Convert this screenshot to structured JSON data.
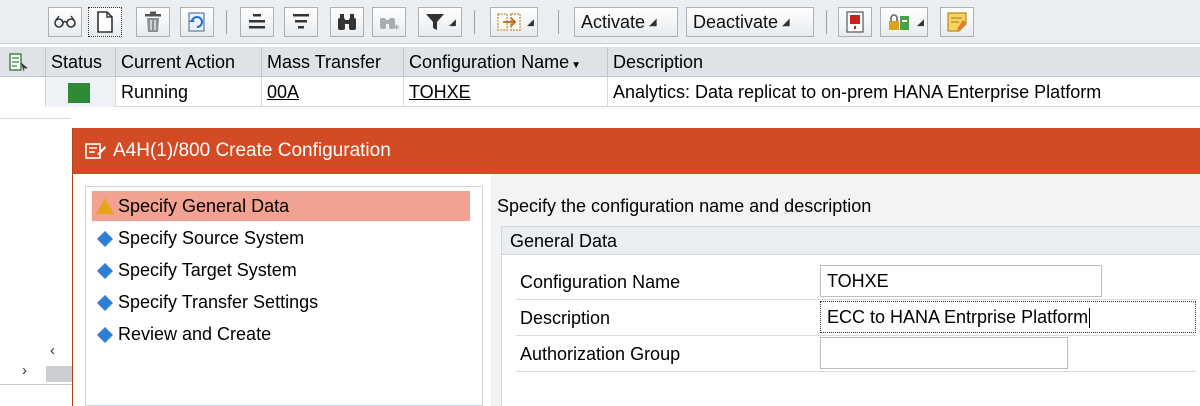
{
  "toolbar": {
    "activate_label": "Activate",
    "deactivate_label": "Deactivate",
    "icons": [
      "glasses-icon",
      "new-document-icon",
      "trash-icon",
      "refresh-icon",
      "align-center-icon",
      "align-icon",
      "binoculars-icon",
      "binoculars-next-icon",
      "filter-icon",
      "transfer-icon",
      "flag-icon",
      "lock-key-icon",
      "note-icon"
    ]
  },
  "table": {
    "columns": [
      "Status",
      "Current Action",
      "Mass Transfer",
      "Configuration Name",
      "Description"
    ],
    "rows": [
      {
        "status_color": "#2f8a36",
        "current_action": "Running",
        "mass_transfer": "00A",
        "configuration_name": "TOHXE",
        "description": "Analytics: Data replicat to on-prem HANA Enterprise Platform"
      }
    ]
  },
  "dialog": {
    "title": "A4H(1)/800 Create Configuration",
    "steps": [
      {
        "label": "Specify General Data",
        "icon": "warning-triangle-icon",
        "active": true
      },
      {
        "label": "Specify Source System",
        "icon": "diamond-icon",
        "active": false
      },
      {
        "label": "Specify Target System",
        "icon": "diamond-icon",
        "active": false
      },
      {
        "label": "Specify Transfer Settings",
        "icon": "diamond-icon",
        "active": false
      },
      {
        "label": "Review and Create",
        "icon": "diamond-icon",
        "active": false
      }
    ],
    "header": "Specify the configuration name and description",
    "group_title": "General Data",
    "fields": {
      "config_name_label": "Configuration Name",
      "config_name_value": "TOHXE",
      "description_label": "Description",
      "description_value": "ECC to HANA Entrprise Platform",
      "auth_group_label": "Authorization Group",
      "auth_group_value": ""
    }
  },
  "colors": {
    "accent": "#d34b25",
    "active_step": "#f2a291",
    "status_running": "#2f8a36",
    "diamond": "#2f7fd4"
  }
}
